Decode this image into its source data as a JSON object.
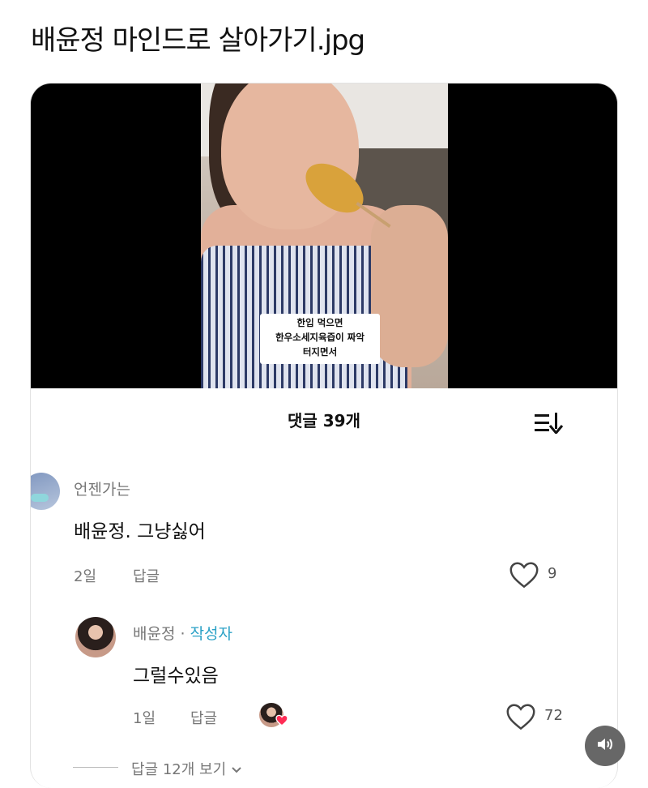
{
  "post": {
    "title": "배윤정 마인드로 살아가기.jpg"
  },
  "video": {
    "caption_line1": "한입 먹으면",
    "caption_line2": "한우소세지육즙이 짜악",
    "caption_line3": "터지면서"
  },
  "comments": {
    "header": "댓글 39개",
    "sort_icon": "sort-icon",
    "items": [
      {
        "username": "언젠가는",
        "text": "배윤정. 그냥싫어",
        "time": "2일",
        "reply_label": "답글",
        "like_count": "9"
      },
      {
        "username": "배윤정",
        "separator": " · ",
        "author_badge": "작성자",
        "text": "그럴수있음",
        "time": "1일",
        "reply_label": "답글",
        "like_count": "72"
      }
    ],
    "view_replies": "답글 12개 보기"
  },
  "colors": {
    "author_badge": "#2aa1c6",
    "heart_red": "#ff2c55",
    "muted_text": "#777777"
  }
}
